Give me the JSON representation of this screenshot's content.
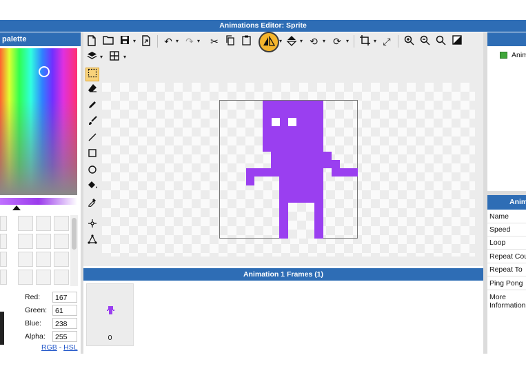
{
  "window": {
    "title": "Animations Editor: Sprite"
  },
  "palette": {
    "header": "palette",
    "color": {
      "red_label": "Red:",
      "red": "167",
      "green_label": "Green:",
      "green": "61",
      "blue_label": "Blue:",
      "blue": "238",
      "alpha_label": "Alpha:",
      "alpha": "255"
    },
    "modes": {
      "rgb": "RGB",
      "separator": "-",
      "hsl": "HSL"
    },
    "sprite_color": "#9a3ff0"
  },
  "toolbar": {
    "icons": [
      "new-file-icon",
      "open-folder-icon",
      "save-icon",
      "export-icon",
      "undo-icon",
      "redo-icon",
      "cut-icon",
      "copy-icon",
      "paste-icon",
      "flip-horizontal-icon",
      "flip-vertical-icon",
      "rotate-left-icon",
      "rotate-right-icon",
      "crop-icon",
      "resize-icon",
      "zoom-in-icon",
      "zoom-out-icon",
      "zoom-fit-icon",
      "transparency-icon",
      "layers-icon",
      "grid-icon"
    ]
  },
  "tools": [
    "select-rect-icon",
    "eraser-icon",
    "pencil-icon",
    "brush-icon",
    "line-icon",
    "rectangle-icon",
    "ellipse-icon",
    "fill-bucket-icon",
    "eyedropper-icon",
    "move-point-icon",
    "polygon-icon"
  ],
  "frames": {
    "header": "Animation 1 Frames (1)",
    "items": [
      {
        "number": "0"
      }
    ]
  },
  "animations": {
    "items": [
      {
        "label": "Anim"
      }
    ]
  },
  "properties": {
    "header": "Anim",
    "rows": [
      "Name",
      "Speed",
      "Loop",
      "Repeat Cou",
      "Repeat To",
      "Ping Pong",
      "More Information"
    ]
  }
}
